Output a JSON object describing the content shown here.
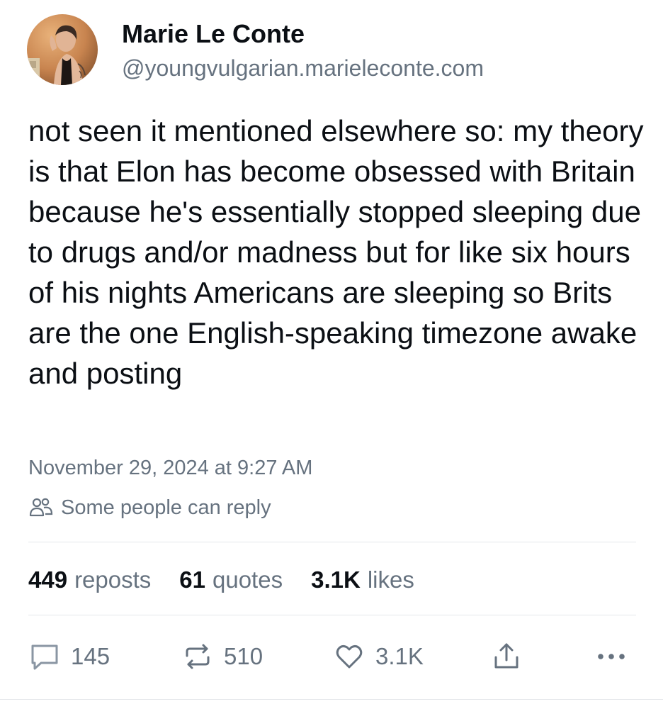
{
  "post": {
    "author": {
      "display_name": "Marie Le Conte",
      "handle": "@youngvulgarian.marieleconte.com",
      "avatar_icon": "avatar-photo"
    },
    "text": "not seen it mentioned elsewhere so: my theory is that Elon has become obsessed with Britain because he's essentially stopped sleeping due to drugs and/or madness but for like six hours of his nights Americans are sleeping so Brits are the one English-speaking timezone awake and posting",
    "timestamp": "November 29, 2024 at 9:27 AM",
    "reply_setting": {
      "icon": "people-icon",
      "label": "Some people can reply"
    },
    "stats": {
      "reposts_count": "449",
      "reposts_label": "reposts",
      "quotes_count": "61",
      "quotes_label": "quotes",
      "likes_count": "3.1K",
      "likes_label": "likes"
    },
    "actions": {
      "reply": {
        "icon": "comment-icon",
        "count": "145"
      },
      "repost": {
        "icon": "repost-icon",
        "count": "510"
      },
      "like": {
        "icon": "heart-icon",
        "count": "3.1K"
      },
      "share": {
        "icon": "share-icon"
      },
      "more": {
        "icon": "more-icon"
      }
    }
  },
  "colors": {
    "text_primary": "#0b0f14",
    "text_secondary": "#66727f",
    "divider": "#e5e8eb",
    "background": "#ffffff"
  }
}
